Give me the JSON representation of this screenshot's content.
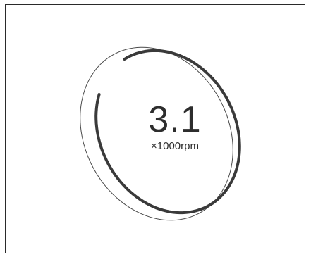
{
  "tachometer": {
    "value": "3.1",
    "unit": "×1000rpm",
    "level_fraction": 0.9,
    "colors": {
      "background": "#ffffff",
      "frame": "#2a2a2a",
      "ring_thin": "#4a4a4a",
      "ring_thick": "#3a3a3a",
      "text": "#2d2d2d"
    }
  }
}
